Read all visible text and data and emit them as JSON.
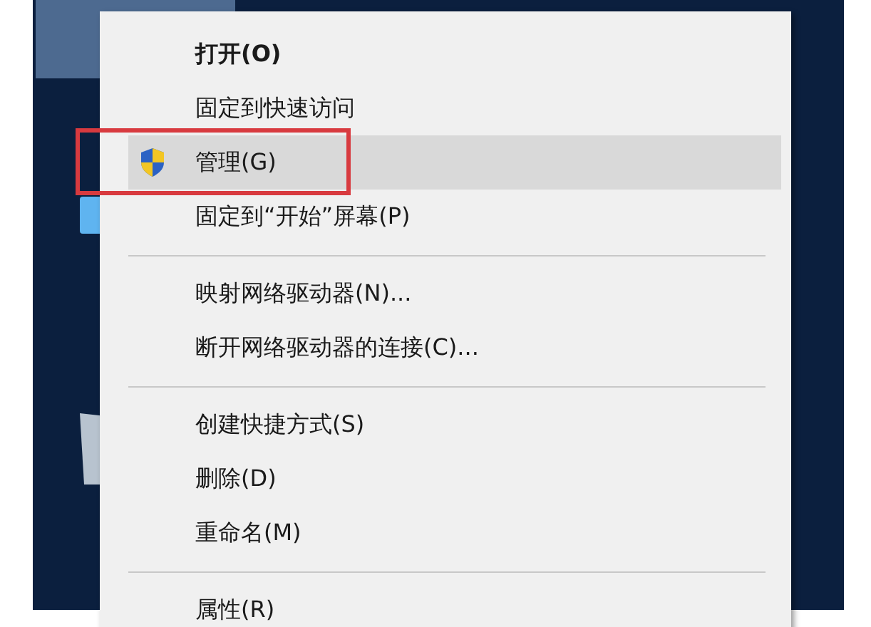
{
  "context_menu": {
    "items": [
      {
        "kind": "item",
        "label": "打开(O)",
        "default": true,
        "selected": false,
        "outlined": false
      },
      {
        "kind": "item",
        "label": "固定到快速访问",
        "default": false,
        "selected": false,
        "outlined": false
      },
      {
        "kind": "shield-item",
        "label": "管理(G)",
        "default": false,
        "selected": true,
        "outlined": true
      },
      {
        "kind": "item",
        "label": "固定到“开始”屏幕(P)",
        "default": false,
        "selected": false,
        "outlined": false
      },
      {
        "kind": "separator"
      },
      {
        "kind": "item",
        "label": "映射网络驱动器(N)...",
        "default": false,
        "selected": false,
        "outlined": false
      },
      {
        "kind": "item",
        "label": "断开网络驱动器的连接(C)...",
        "default": false,
        "selected": false,
        "outlined": false
      },
      {
        "kind": "separator"
      },
      {
        "kind": "item",
        "label": "创建快捷方式(S)",
        "default": false,
        "selected": false,
        "outlined": false
      },
      {
        "kind": "item",
        "label": "删除(D)",
        "default": false,
        "selected": false,
        "outlined": false
      },
      {
        "kind": "item",
        "label": "重命名(M)",
        "default": false,
        "selected": false,
        "outlined": false
      },
      {
        "kind": "separator"
      },
      {
        "kind": "item",
        "label": "属性(R)",
        "default": false,
        "selected": false,
        "outlined": false
      }
    ]
  }
}
